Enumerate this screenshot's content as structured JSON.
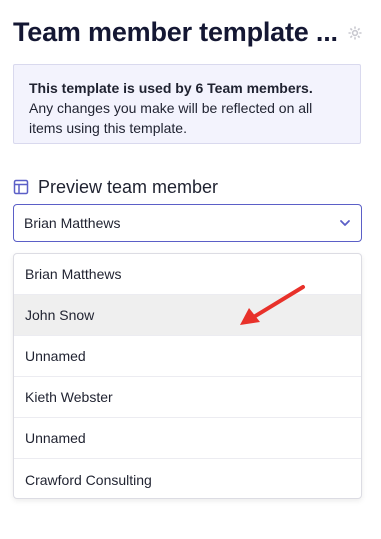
{
  "header": {
    "title": "Team member template ...",
    "settings_icon": "gear-icon"
  },
  "info": {
    "strong": "This template is used by 6 Team members.",
    "text": "Any changes you make will be reflected on all items using this template."
  },
  "preview": {
    "icon": "layout-icon",
    "label": "Preview team member",
    "selected": "Brian Matthews",
    "options": [
      "Brian Matthews",
      "John Snow",
      "Unnamed",
      "Kieth Webster",
      "Unnamed",
      "Crawford Consulting"
    ],
    "highlighted_option": "John Snow"
  },
  "colors": {
    "accent": "#5b5fc7",
    "info_bg": "#f3f3fd",
    "annotation_arrow": "#e8312a"
  }
}
